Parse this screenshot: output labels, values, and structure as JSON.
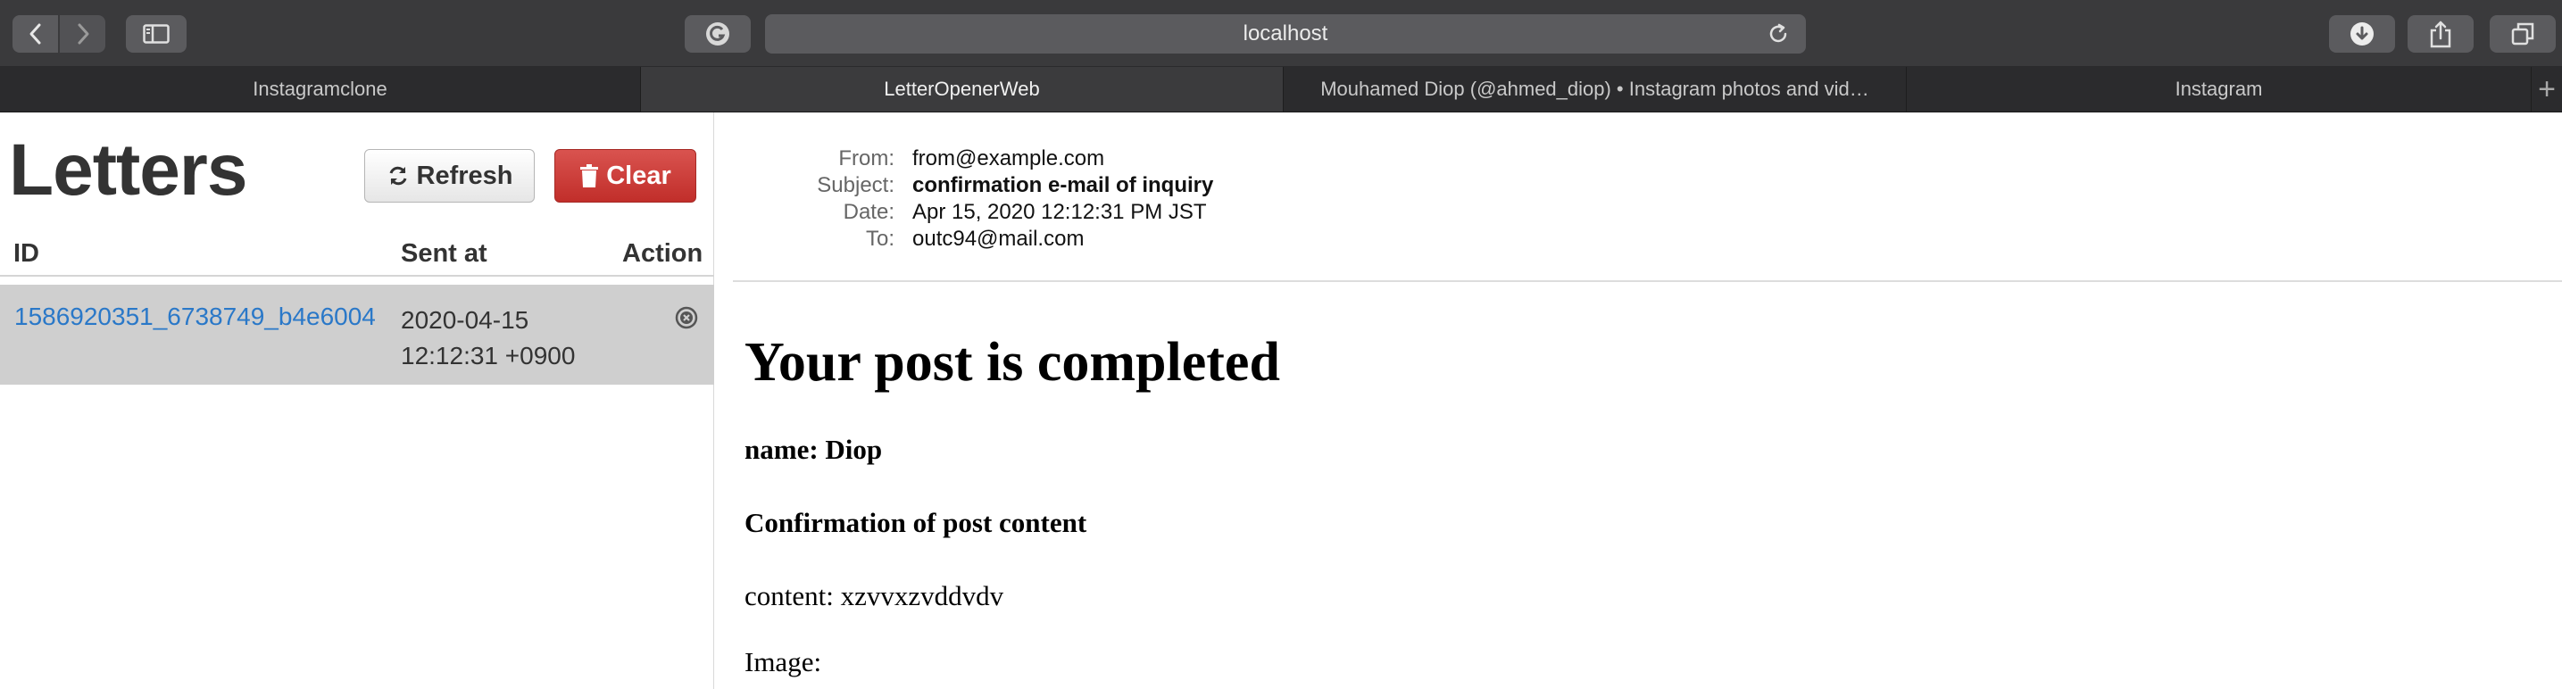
{
  "browser": {
    "address": "localhost",
    "tabs": [
      {
        "label": "Instagramclone"
      },
      {
        "label": "LetterOpenerWeb"
      },
      {
        "label": "Mouhamed Diop (@ahmed_diop) • Instagram photos and vid…"
      },
      {
        "label": "Instagram"
      }
    ],
    "new_tab": "+"
  },
  "letters": {
    "title": "Letters",
    "refresh_label": "Refresh",
    "clear_label": "Clear",
    "columns": {
      "id": "ID",
      "sent_at": "Sent at",
      "action": "Action"
    },
    "rows": [
      {
        "id": "1586920351_6738749_b4e6004",
        "sent_date": "2020-04-15",
        "sent_time": "12:12:31 +0900"
      }
    ]
  },
  "message": {
    "headers": {
      "from_label": "From:",
      "from": "from@example.com",
      "subject_label": "Subject:",
      "subject": "confirmation e-mail of inquiry",
      "date_label": "Date:",
      "date": "Apr 15, 2020 12:12:31 PM JST",
      "to_label": "To:",
      "to": "outc94@mail.com"
    },
    "body": {
      "heading": "Your post is completed",
      "name_line": "name: Diop",
      "confirm_line": "Confirmation of post content",
      "content_line": "content: xzvvxzvddvdv",
      "image_line": "Image:"
    }
  },
  "colors": {
    "toolbar": "#3a3a3c",
    "link": "#2a78c8",
    "clear_button": "#c9302c",
    "selected_row": "#cfcfcf"
  },
  "icons": {
    "back": "chevron-left-icon",
    "forward": "chevron-right-icon",
    "sidebar": "sidebar-icon",
    "grammarly": "grammarly-icon",
    "reload": "reload-icon",
    "download": "download-icon",
    "share": "share-icon",
    "tabs": "tab-overview-icon",
    "refresh": "refresh-icon",
    "clear": "trash-icon",
    "remove": "remove-circle-icon"
  }
}
